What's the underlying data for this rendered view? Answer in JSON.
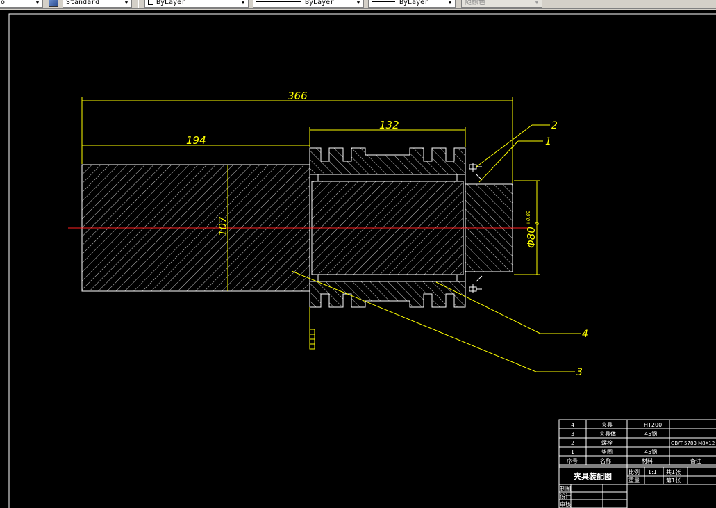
{
  "toolbar": {
    "text_style": "Standard",
    "layer": "ByLayer",
    "linetype": "ByLayer",
    "lineweight": "ByLayer",
    "plot_style": "随颜色"
  },
  "drawing": {
    "dimensions": {
      "overall_length": "366",
      "left_length": "194",
      "sleeve_length": "132",
      "left_diameter": "107",
      "bore_diameter": "Φ80",
      "bore_tolerance_upper": "+0.02",
      "bore_tolerance_lower": "0"
    },
    "balloons": [
      "1",
      "2",
      "3",
      "4"
    ]
  },
  "title_block": {
    "parts": [
      {
        "no": "4",
        "name": "夹具",
        "material": "HT200",
        "note": ""
      },
      {
        "no": "3",
        "name": "夹具体",
        "material": "45钢",
        "note": ""
      },
      {
        "no": "2",
        "name": "螺栓",
        "material": "",
        "note": "GB/T 5783 M8X12"
      },
      {
        "no": "1",
        "name": "垫圈",
        "material": "45钢",
        "note": ""
      }
    ],
    "header": {
      "no": "序号",
      "name": "名称",
      "material": "材料",
      "note": "备注"
    },
    "drawing_name": "夹具装配图",
    "scale_label": "比例",
    "scale_value": "1:1",
    "sheets_total": "共1张",
    "weight_label": "重量",
    "sheet_no": "第1张",
    "drawn_label": "制图",
    "design_label": "设计",
    "review_label": "审核"
  },
  "colors": {
    "background": "#000000",
    "geometry": "#ffffff",
    "dimension": "#ffff00",
    "centerline": "#ff0000"
  }
}
